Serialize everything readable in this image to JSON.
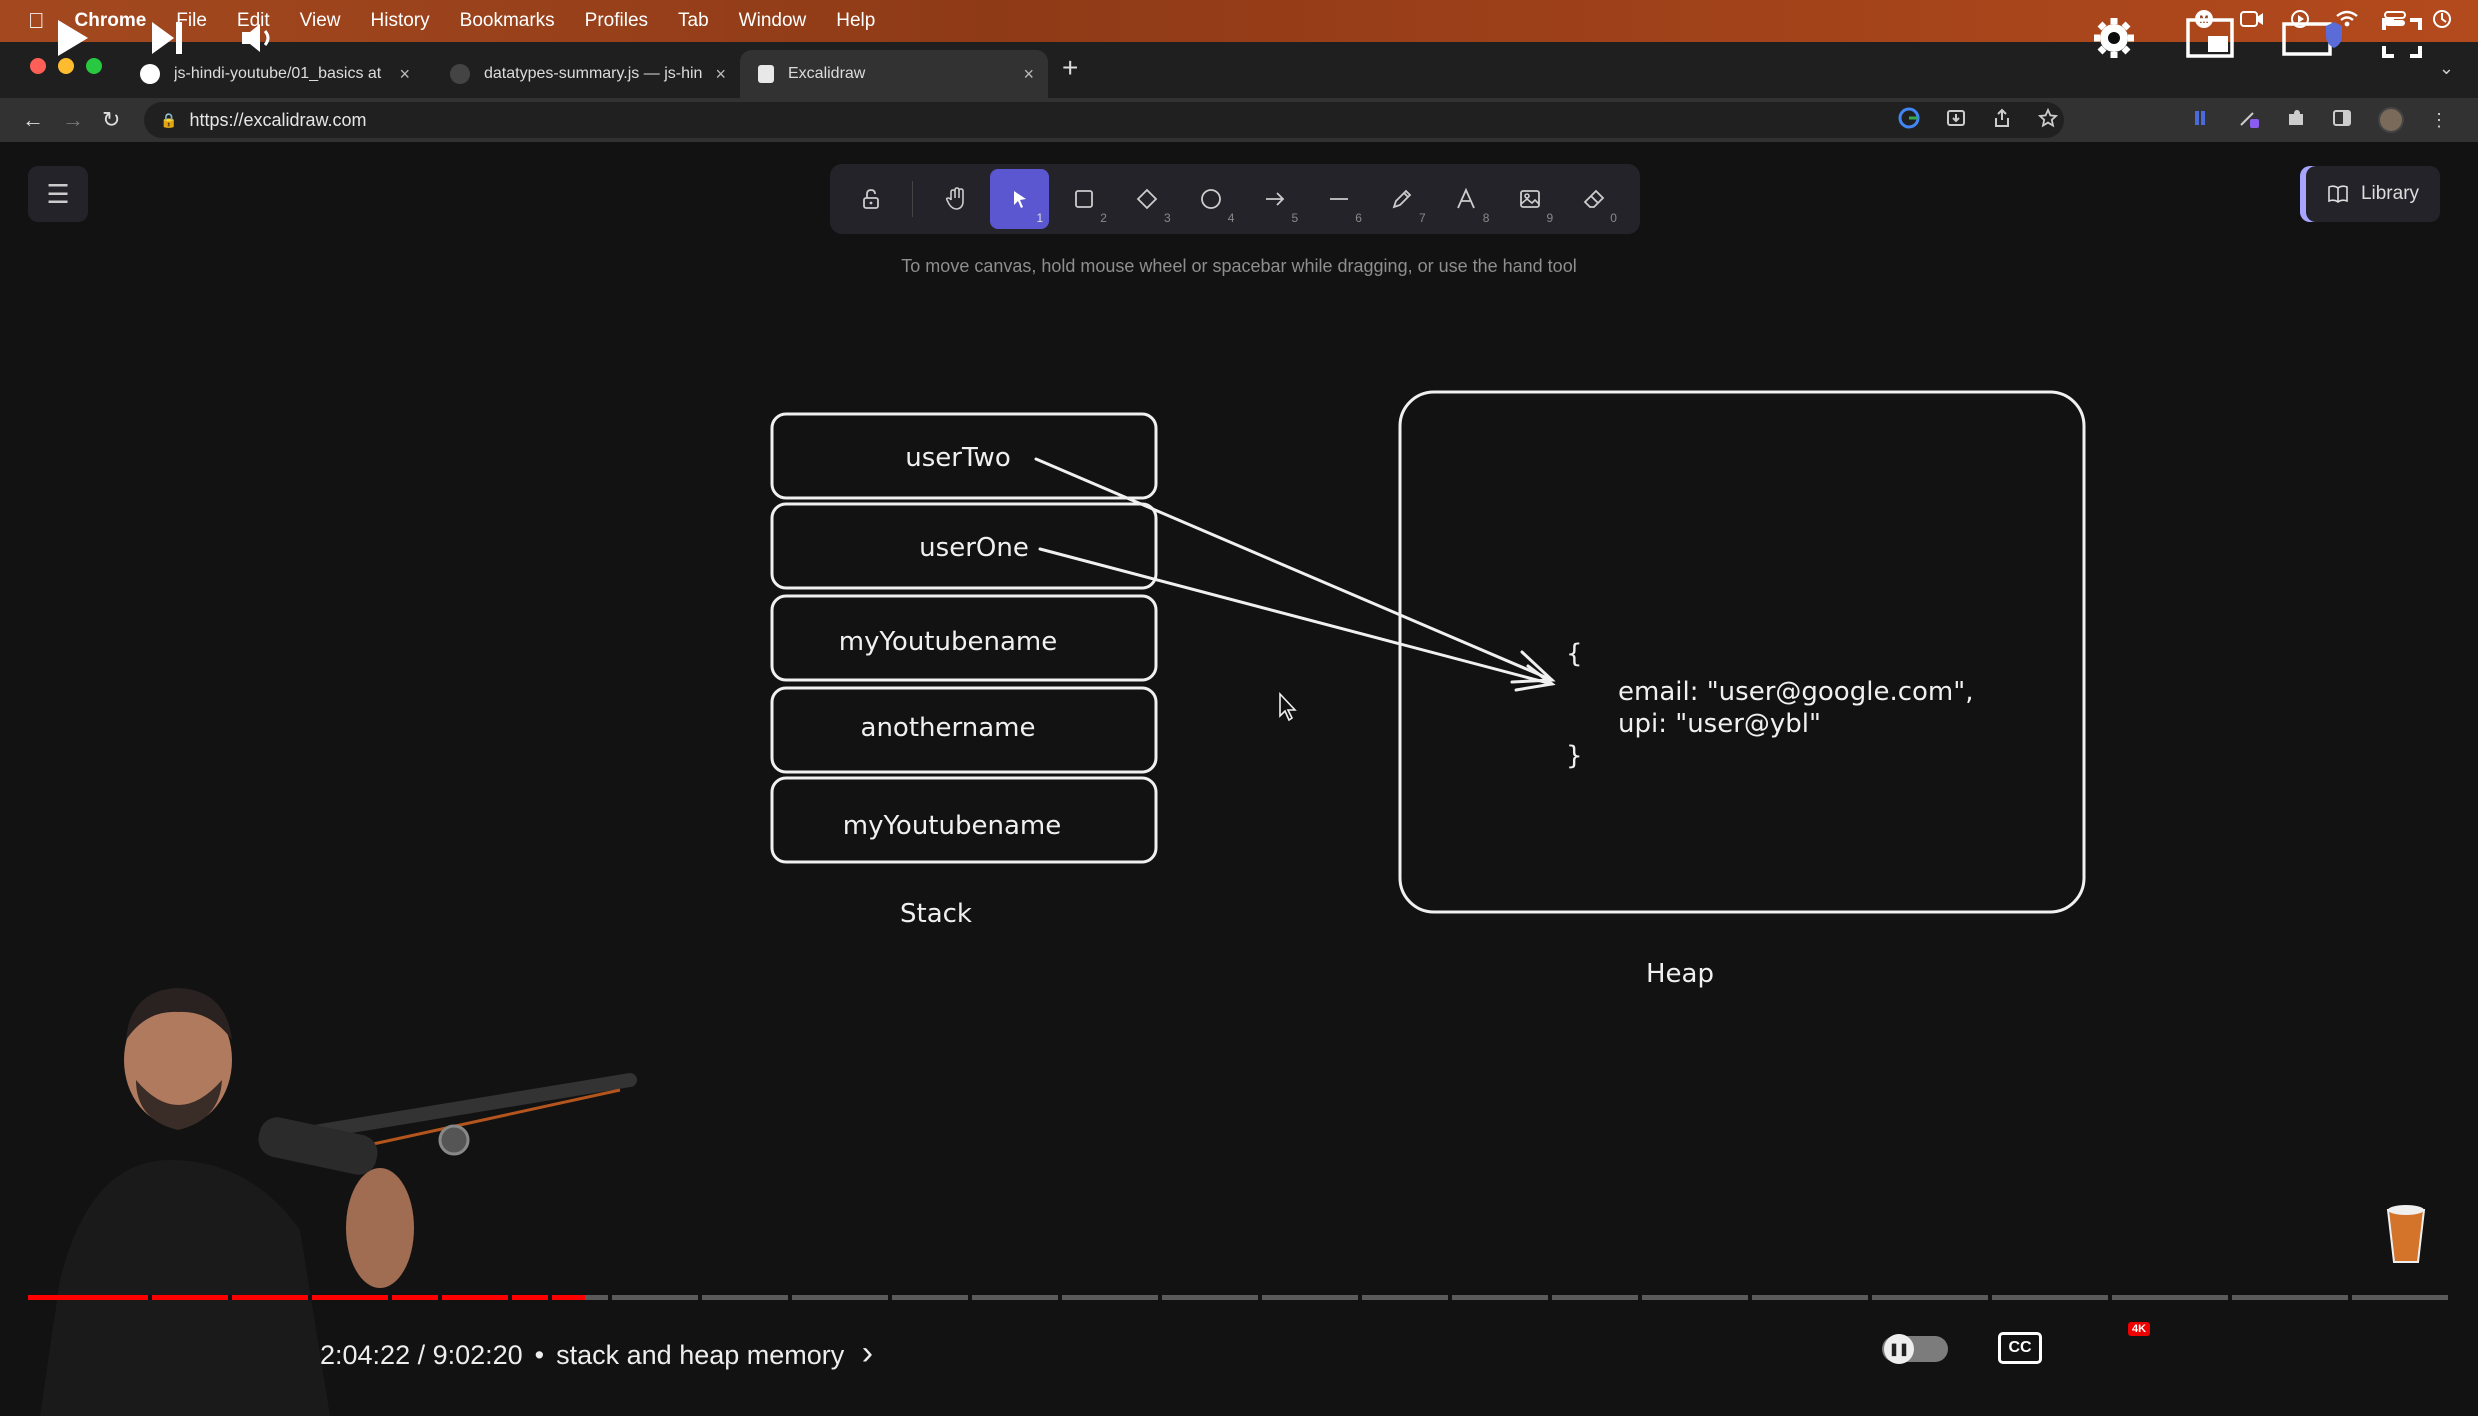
{
  "menubar": {
    "app": "Chrome",
    "items": [
      "File",
      "Edit",
      "View",
      "History",
      "Bookmarks",
      "Profiles",
      "Tab",
      "Window",
      "Help"
    ]
  },
  "tabs": [
    {
      "title": "js-hindi-youtube/01_basics at",
      "close": "×"
    },
    {
      "title": "datatypes-summary.js — js-hin",
      "close": "×"
    },
    {
      "title": "Excalidraw",
      "close": "×"
    }
  ],
  "newtab": "+",
  "address": {
    "url": "https://excalidraw.com"
  },
  "excalidraw": {
    "hint": "To move canvas, hold mouse wheel or spacebar while dragging, or use the hand tool",
    "library_label": "Library",
    "tools": [
      {
        "name": "hand",
        "num": ""
      },
      {
        "name": "selection",
        "num": "1"
      },
      {
        "name": "rectangle",
        "num": "2"
      },
      {
        "name": "diamond",
        "num": "3"
      },
      {
        "name": "ellipse",
        "num": "4"
      },
      {
        "name": "arrow",
        "num": "5"
      },
      {
        "name": "line",
        "num": "6"
      },
      {
        "name": "draw",
        "num": "7"
      },
      {
        "name": "text",
        "num": "8"
      },
      {
        "name": "image",
        "num": "9"
      },
      {
        "name": "eraser",
        "num": "0"
      }
    ]
  },
  "diagram": {
    "stack_items": [
      "userTwo",
      "userOne",
      "myYoutubename",
      "anothername",
      "myYoutubename"
    ],
    "stack_label": "Stack",
    "heap_label": "Heap",
    "heap_object": {
      "open": "{",
      "line1": "email: \"user@google.com\",",
      "line2": "upi: \"user@ybl\"",
      "close": "}"
    }
  },
  "player": {
    "time": "2:04:22 / 9:02:20",
    "separator": "•",
    "chapter": "stack and heap memory",
    "chevron": "›",
    "cc_label": "CC",
    "hd_badge": "4K",
    "progress_fraction": 0.23
  }
}
